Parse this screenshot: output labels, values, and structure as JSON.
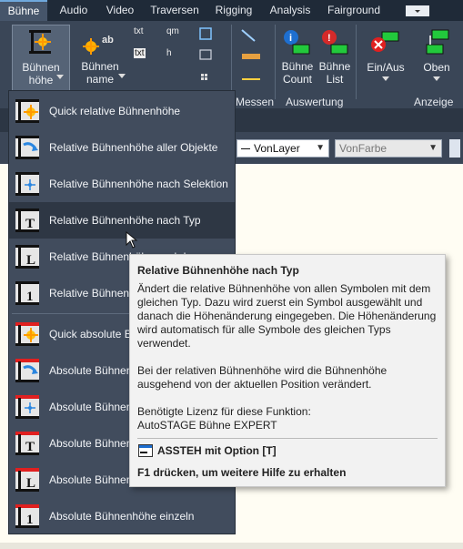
{
  "tabs": [
    "Bühne",
    "Audio",
    "Video",
    "Traversen",
    "Rigging",
    "Analysis",
    "Fairground"
  ],
  "ribbon": {
    "buehnenhoehe": "Bühnen\nhöhe",
    "buehnenname": "Bühnen\nname",
    "txt1": "txt",
    "txt2": "txt",
    "qm": "qm",
    "h": "h",
    "buehne_count": "Bühne\nCount",
    "buehne_list": "Bühne\nList",
    "ein_aus": "Ein/Aus",
    "oben": "Oben",
    "groups": {
      "messen": "Messen",
      "auswertung": "Auswertung",
      "anzeige": "Anzeige"
    }
  },
  "propbar": {
    "layer": "VonLayer",
    "color": "VonFarbe"
  },
  "menu": {
    "items": [
      "Quick relative Bühnenhöhe",
      "Relative Bühnenhöhe aller Objekte",
      "Relative Bühnenhöhe nach Selektion",
      "Relative Bühnenhöhe nach Typ",
      "Relative Bühnenhöhe nach Layer",
      "Relative Bühnenhöhe einzeln",
      "Quick absolute Bühnenhöhe",
      "Absolute Bühnenhöhe aller Objekte",
      "Absolute Bühnenhöhe nach Selektion",
      "Absolute Bühnenhöhe nach Typ",
      "Absolute Bühnenhöhe nach Layer",
      "Absolute Bühnenhöhe einzeln"
    ]
  },
  "tooltip": {
    "title": "Relative Bühnenhöhe nach Typ",
    "p1": "Ändert die relative Bühnenhöhe von allen Symbolen mit dem gleichen Typ. Dazu wird zuerst ein Symbol ausgewählt und danach die Höhenänderung eingegeben. Die Höhenänderung wird automatisch für alle Symbole des gleichen Typs verwendet.",
    "p2": "Bei der relativen Bühnenhöhe wird die Bühnenhöhe ausgehend von der aktuellen Position verändert.",
    "p3": "Benötigte Lizenz für diese Funktion:\nAutoSTAGE Bühne EXPERT",
    "command": "ASSTEH mit Option [T]",
    "help": "F1 drücken, um weitere Hilfe zu erhalten"
  },
  "colors": {
    "accent_red": "#e02020",
    "menu_bg": "#414c5d",
    "tab_bg": "#1f2a38"
  }
}
